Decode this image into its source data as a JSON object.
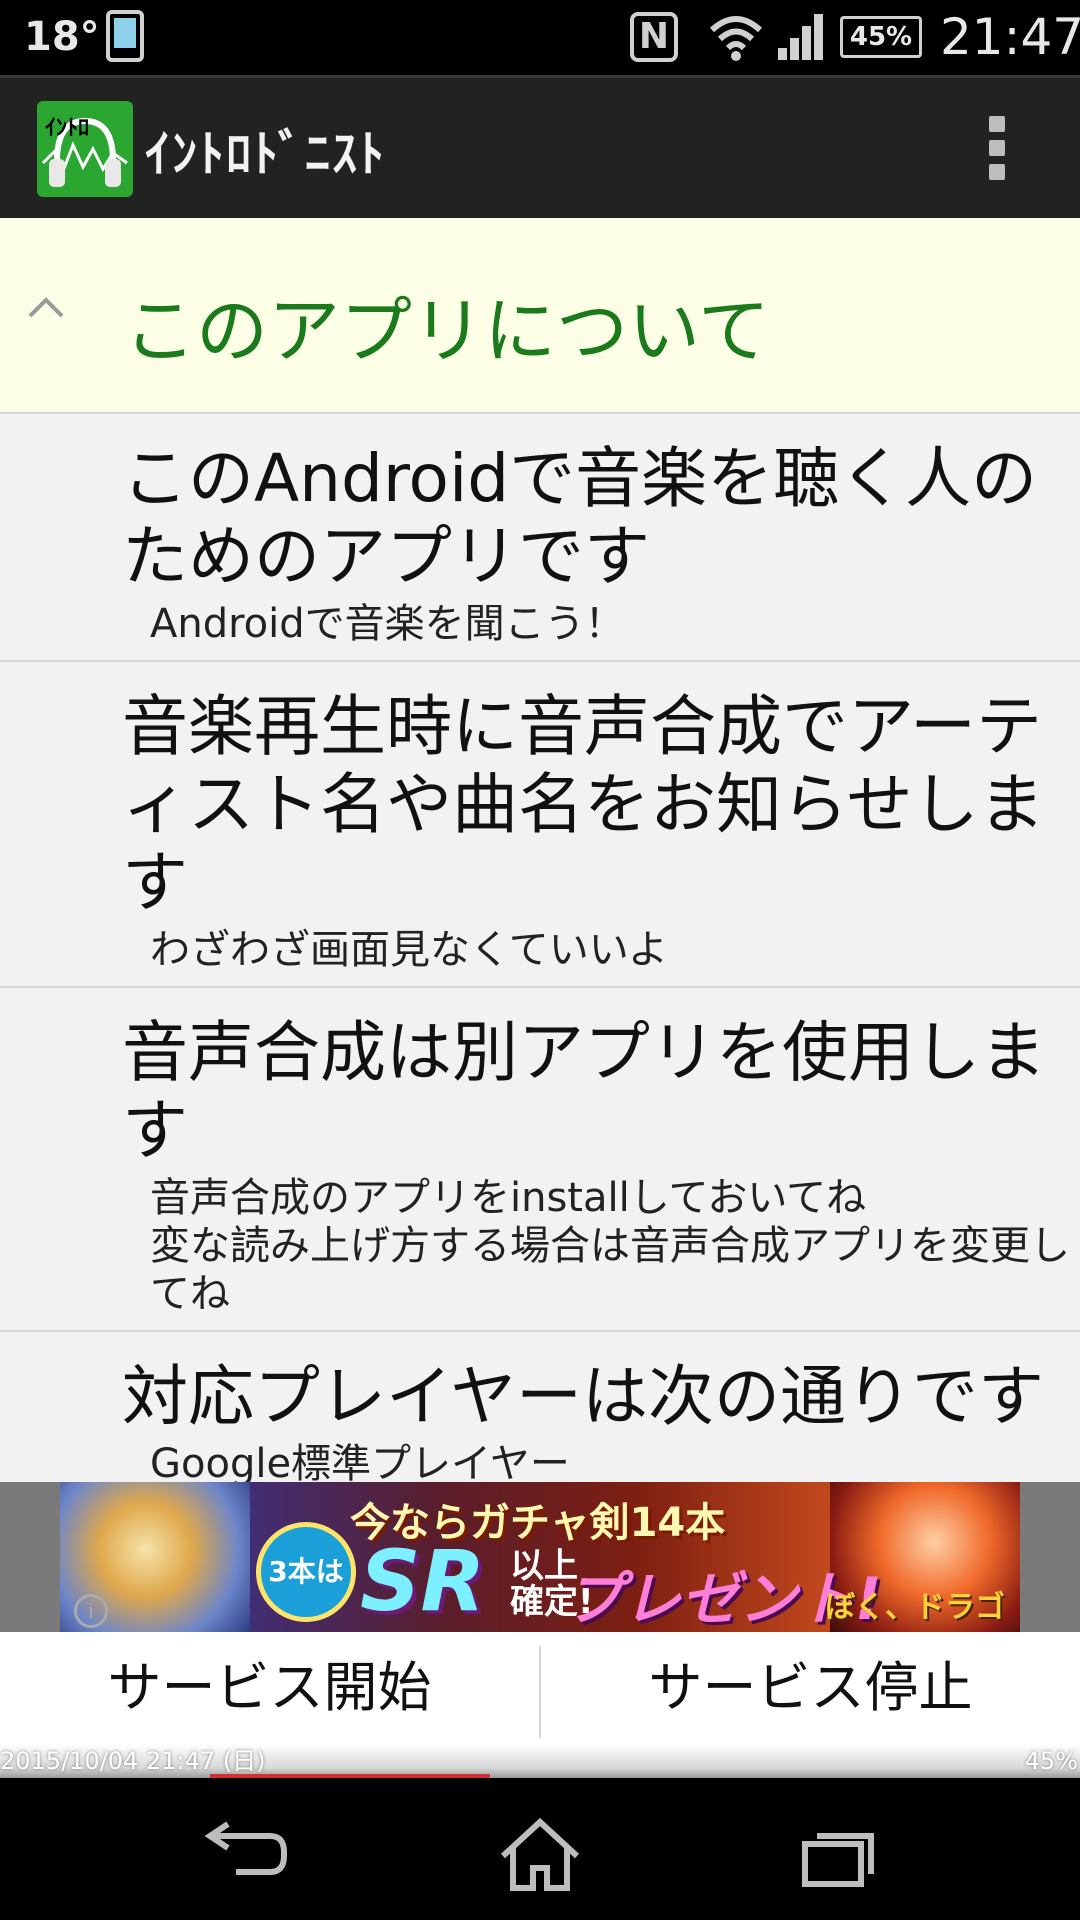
{
  "status_bar": {
    "temperature": "18°",
    "nfc": "N",
    "battery": "45%",
    "time": "21:47",
    "icons": [
      "phone-icon",
      "nfc-icon",
      "wifi-icon",
      "signal-icon",
      "battery-icon"
    ]
  },
  "app_bar": {
    "title": "ｲﾝﾄﾛﾄﾞﾆｽﾄ",
    "logo_icon": "app-logo-icon",
    "overflow_icon": "overflow-menu-icon"
  },
  "section": {
    "title": "このアプリについて",
    "toggle_icon": "chevron-up-icon"
  },
  "items": [
    {
      "title": "このAndroidで音楽を聴く人のためのアプリです",
      "subtitle": "Androidで音楽を聞こう！"
    },
    {
      "title": "音楽再生時に音声合成でアーティスト名や曲名をお知らせします",
      "subtitle": "わざわざ画面見なくていいよ"
    },
    {
      "title": "音声合成は別アプリを使用します",
      "subtitle": "音声合成のアプリをinstallしておいてね\n変な読み上げ方する場合は音声合成アプリを変更してね"
    },
    {
      "title": "対応プレイヤーは次の通りです",
      "subtitle": "Google標準プレイヤー"
    }
  ],
  "ad": {
    "badge": "3本は",
    "top_text": "今ならガチャ剣14本",
    "sr_text": "SR",
    "kakutei": "以上\n確定!",
    "present": "プレゼント!",
    "logo": "ぼく、ドラゴン",
    "info_icon": "ad-info-icon"
  },
  "buttons": {
    "start": "サービス開始",
    "stop": "サービス停止"
  },
  "overlay": {
    "datetime": "2015/10/04  21:47 (日)",
    "battery": "45%"
  },
  "nav": {
    "back_icon": "back-icon",
    "home_icon": "home-icon",
    "recents_icon": "recents-icon"
  }
}
